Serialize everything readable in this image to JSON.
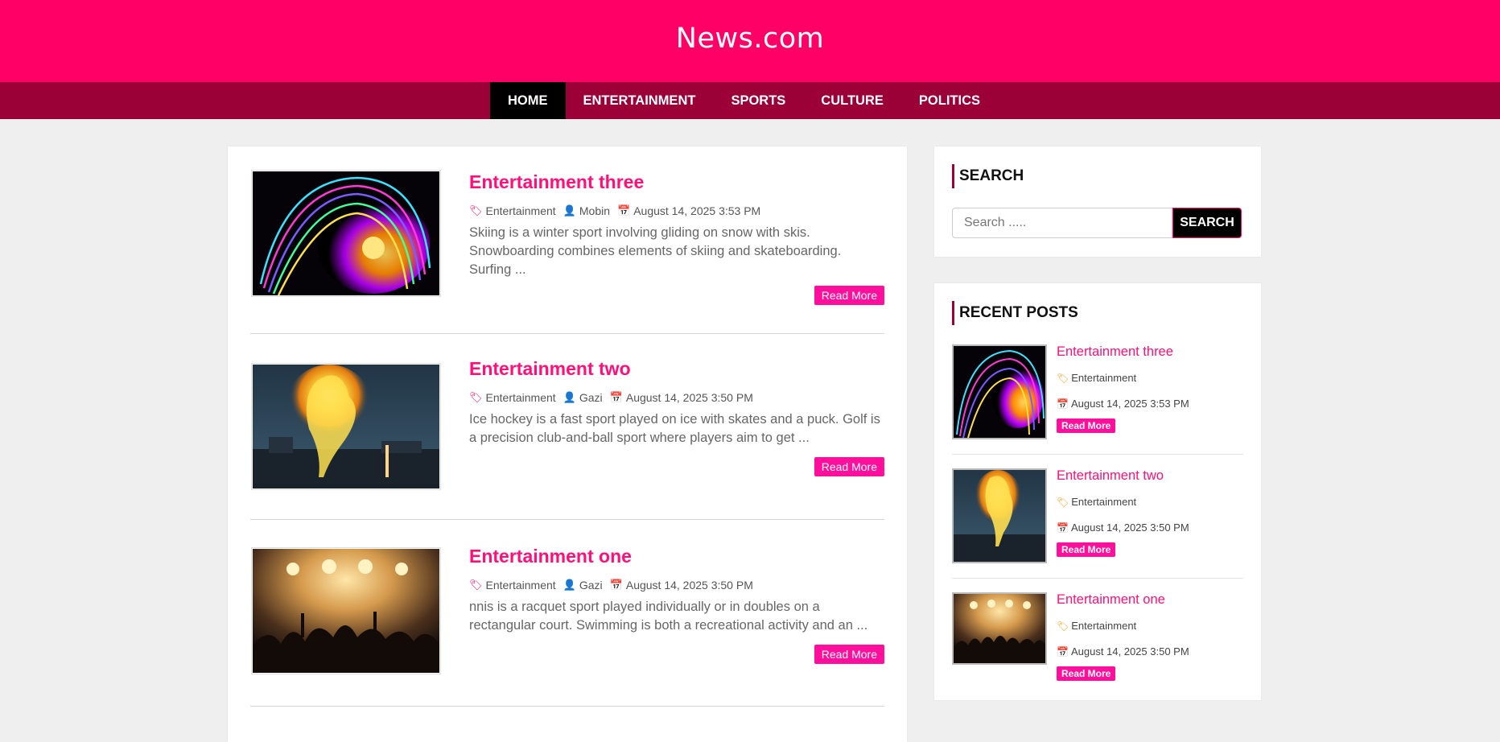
{
  "site": {
    "title": "News.com"
  },
  "nav": {
    "items": [
      {
        "label": "HOME"
      },
      {
        "label": "ENTERTAINMENT"
      },
      {
        "label": "SPORTS"
      },
      {
        "label": "CULTURE"
      },
      {
        "label": "POLITICS"
      }
    ]
  },
  "articles": [
    {
      "title": "Entertainment three",
      "category": "Entertainment",
      "author": "Mobin",
      "date": "August 14, 2025 3:53 PM",
      "excerpt": "Skiing is a winter sport involving gliding on snow with skis. Snowboarding combines elements of skiing and skateboarding. Surfing ...",
      "read_more": "Read More"
    },
    {
      "title": "Entertainment two",
      "category": "Entertainment",
      "author": "Gazi",
      "date": "August 14, 2025 3:50 PM",
      "excerpt": "Ice hockey is a fast sport played on ice with skates and a puck. Golf is a precision club-and-ball sport where players aim to get ...",
      "read_more": "Read More"
    },
    {
      "title": "Entertainment one",
      "category": "Entertainment",
      "author": "Gazi",
      "date": "August 14, 2025 3:50 PM",
      "excerpt": "nnis is a racquet sport played individually or in doubles on a rectangular court. Swimming is both a recreational activity and an ...",
      "read_more": "Read More"
    }
  ],
  "sidebar": {
    "search": {
      "title": "SEARCH",
      "placeholder": "Search .....",
      "button": "SEARCH"
    },
    "recent": {
      "title": "RECENT POSTS",
      "items": [
        {
          "title": "Entertainment three",
          "category": "Entertainment",
          "date": "August 14, 2025 3:53 PM",
          "read_more": "Read More"
        },
        {
          "title": "Entertainment two",
          "category": "Entertainment",
          "date": "August 14, 2025 3:50 PM",
          "read_more": "Read More"
        },
        {
          "title": "Entertainment one",
          "category": "Entertainment",
          "date": "August 14, 2025 3:50 PM",
          "read_more": "Read More"
        }
      ]
    }
  },
  "colors": {
    "header": "#ff0066",
    "nav": "#9b0036",
    "accent": "#ff0f77",
    "button": "#ff0f9b"
  }
}
